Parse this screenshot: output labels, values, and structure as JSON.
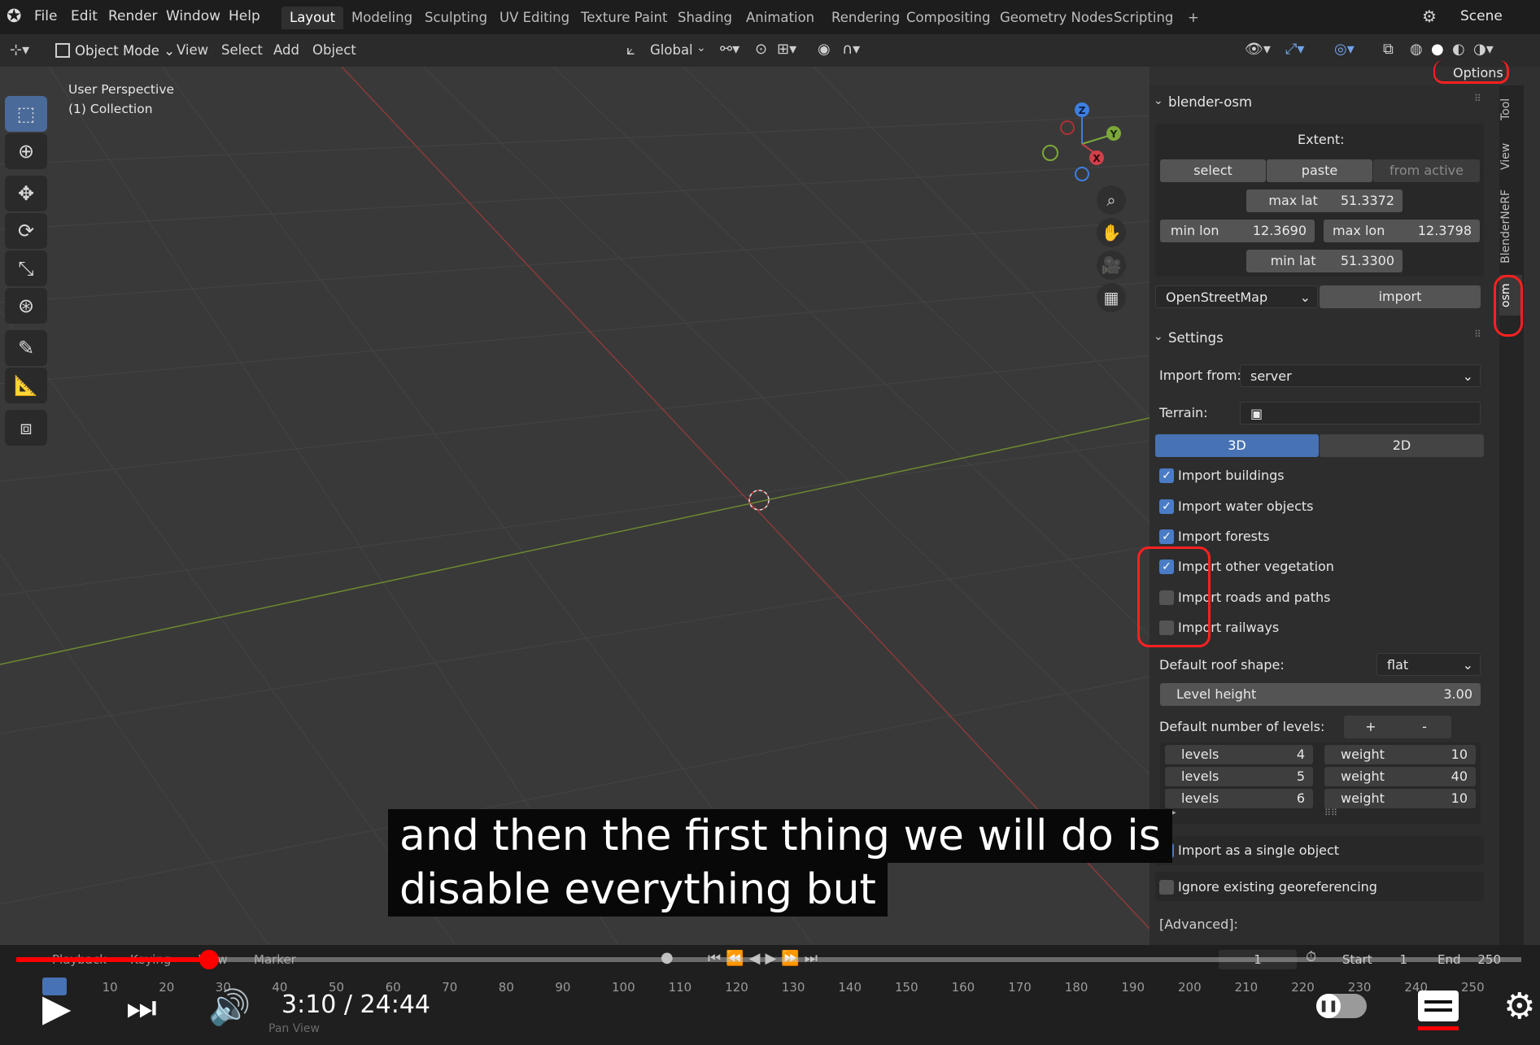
{
  "top_menu": {
    "items": [
      "File",
      "Edit",
      "Render",
      "Window",
      "Help"
    ],
    "workspaces": [
      "Layout",
      "Modeling",
      "Sculpting",
      "UV Editing",
      "Texture Paint",
      "Shading",
      "Animation",
      "Rendering",
      "Compositing",
      "Geometry Nodes",
      "Scripting",
      "+"
    ],
    "active_workspace": "Layout",
    "scene_label": "Scene"
  },
  "header": {
    "mode": "Object Mode",
    "menus": [
      "View",
      "Select",
      "Add",
      "Object"
    ],
    "orientation": "Global",
    "options": "Options"
  },
  "viewport": {
    "perspective": "User Perspective",
    "collection": "(1) Collection",
    "gizmo_axes": [
      "Z",
      "Y",
      "X"
    ]
  },
  "side_tabs": [
    "Tool",
    "View",
    "BlenderNeRF",
    "osm"
  ],
  "osm_panel": {
    "title": "blender-osm",
    "extent_label": "Extent:",
    "extent_buttons": [
      "select",
      "paste",
      "from active"
    ],
    "max_lat": {
      "label": "max lat",
      "value": "51.3372"
    },
    "min_lon": {
      "label": "min lon",
      "value": "12.3690"
    },
    "max_lon": {
      "label": "max lon",
      "value": "12.3798"
    },
    "min_lat": {
      "label": "min lat",
      "value": "51.3300"
    },
    "source": "OpenStreetMap",
    "import_button": "import"
  },
  "settings": {
    "title": "Settings",
    "import_from_label": "Import from:",
    "import_from_value": "server",
    "terrain_label": "Terrain:",
    "mode_tabs": [
      "3D",
      "2D"
    ],
    "active_mode": "3D",
    "checkboxes": [
      {
        "label": "Import buildings",
        "checked": true
      },
      {
        "label": "Import water objects",
        "checked": true
      },
      {
        "label": "Import forests",
        "checked": true
      },
      {
        "label": "Import other vegetation",
        "checked": true
      },
      {
        "label": "Import roads and paths",
        "checked": false
      },
      {
        "label": "Import railways",
        "checked": false
      }
    ],
    "roof_label": "Default roof shape:",
    "roof_value": "flat",
    "level_height_label": "Level height",
    "level_height_value": "3.00",
    "levels_label": "Default number of levels:",
    "plus": "+",
    "minus": "-",
    "levels_rows": [
      {
        "levels_label": "levels",
        "levels": "4",
        "weight_label": "weight",
        "weight": "10"
      },
      {
        "levels_label": "levels",
        "levels": "5",
        "weight_label": "weight",
        "weight": "40"
      },
      {
        "levels_label": "levels",
        "levels": "6",
        "weight_label": "weight",
        "weight": "10"
      }
    ],
    "single_object": {
      "label": "Import as a single object",
      "checked": true
    },
    "ignore_geo": {
      "label": "Ignore existing georeferencing",
      "checked": false
    },
    "advanced": "[Advanced]:"
  },
  "timeline": {
    "menus": [
      "Playback",
      "Keying",
      "View",
      "Marker"
    ],
    "current_frame": "1",
    "start_label": "Start",
    "start_value": "1",
    "end_label": "End",
    "end_value": "250",
    "ruler": [
      "1",
      "10",
      "20",
      "30",
      "40",
      "50",
      "60",
      "70",
      "80",
      "90",
      "100",
      "110",
      "120",
      "130",
      "140",
      "150",
      "160",
      "170",
      "180",
      "190",
      "200",
      "210",
      "220",
      "230",
      "240",
      "250"
    ],
    "status": "Pan View"
  },
  "player": {
    "time": "3:10 / 24:44",
    "progress": 0.128
  },
  "caption": {
    "line1": "and then the first thing we will do is",
    "line2": "disable everything but"
  }
}
